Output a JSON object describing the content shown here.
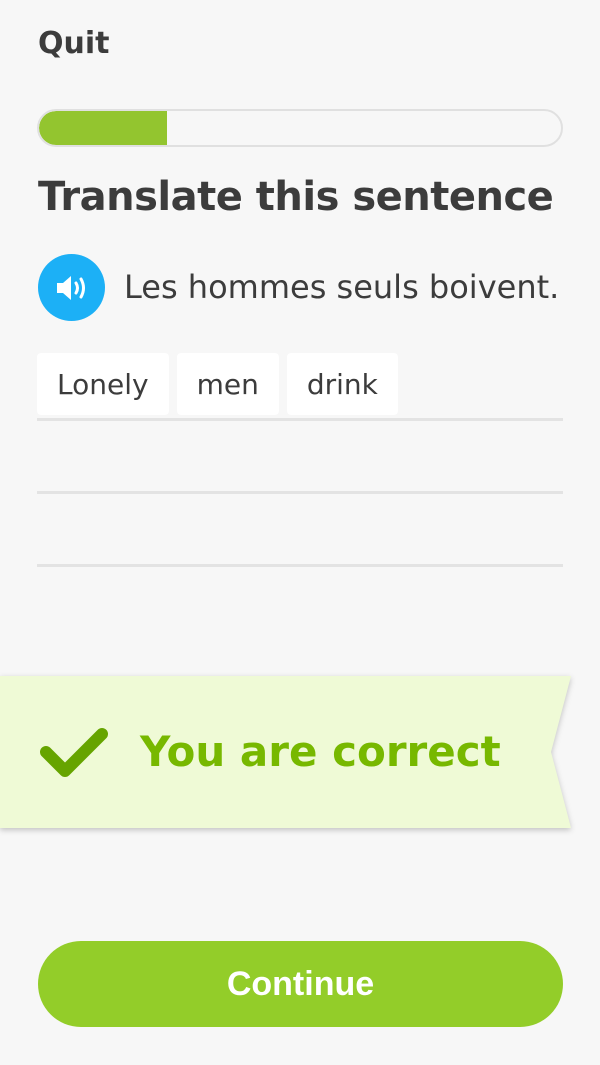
{
  "header": {
    "quit_label": "Quit"
  },
  "progress": {
    "fraction": 0.245
  },
  "exercise": {
    "instruction": "Translate this sentence",
    "prompt_sentence": "Les hommes seuls boivent.",
    "speaker_icon": "speaker-icon"
  },
  "answer": {
    "tiles": [
      "Lonely",
      "men",
      "drink"
    ]
  },
  "feedback": {
    "message": "You are correct",
    "icon": "checkmark-icon"
  },
  "footer": {
    "continue_label": "Continue"
  },
  "colors": {
    "background": "#f7f7f7",
    "progress_fill": "#93c52f",
    "speaker_blue": "#1cb0f6",
    "banner_bg": "#effad6",
    "correct_green": "#77b800",
    "continue_green": "#93cd29"
  }
}
